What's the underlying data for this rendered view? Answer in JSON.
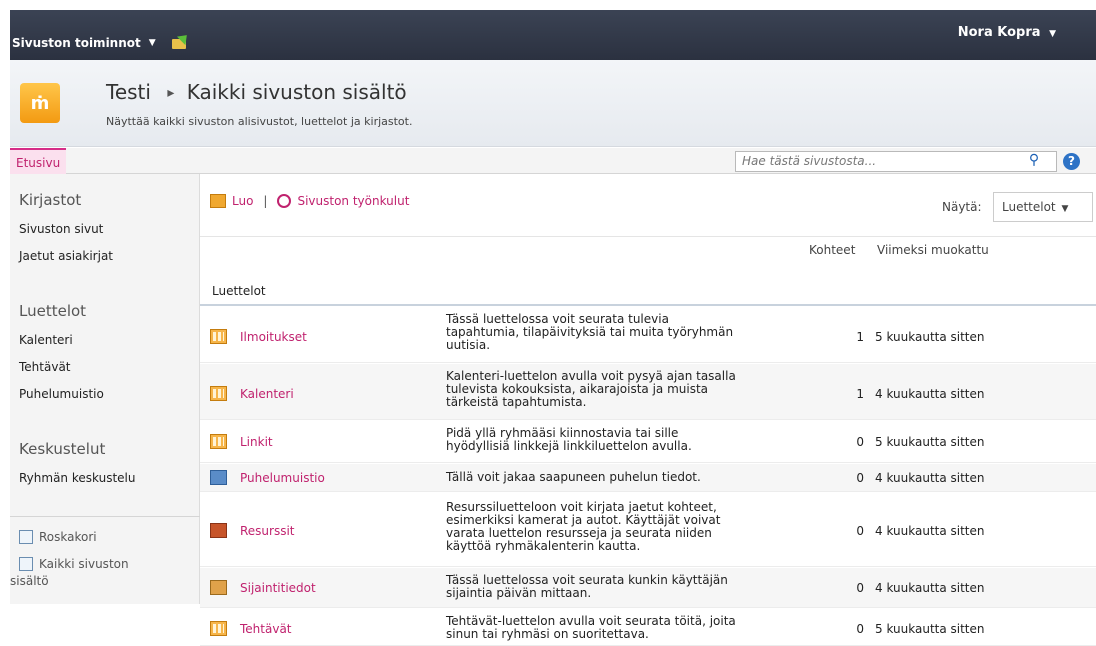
{
  "topbar": {
    "site_actions": "Sivuston toiminnot",
    "user_name": "Nora Kopra"
  },
  "title_area": {
    "site_name": "Testi",
    "page_name": "Kaikki sivuston sisältö",
    "description": "Näyttää kaikki sivuston alisivustot, luettelot ja kirjastot."
  },
  "linkbar": {
    "home_tab": "Etusivu",
    "search_placeholder": "Hae tästä sivustosta..."
  },
  "quicklaunch": {
    "libraries_heading": "Kirjastot",
    "libraries": [
      "Sivuston sivut",
      "Jaetut asiakirjat"
    ],
    "lists_heading": "Luettelot",
    "lists": [
      "Kalenteri",
      "Tehtävät",
      "Puhelumuistio"
    ],
    "discussions_heading": "Keskustelut",
    "discussions": [
      "Ryhmän keskustelu"
    ],
    "recycle_bin": "Roskakori",
    "all_content_line1": "Kaikki sivuston",
    "all_content_line2": "sisältö"
  },
  "toolbar": {
    "create": "Luo",
    "separator": "|",
    "site_workflows": "Sivuston työnkulut",
    "view_label": "Näytä:",
    "view_value": "Luettelot"
  },
  "columns": {
    "items": "Kohteet",
    "modified": "Viimeksi muokattu"
  },
  "section": {
    "title": "Luettelot"
  },
  "rows": [
    {
      "icon": "list-icon",
      "name": "Ilmoitukset",
      "desc1": "Tässä luettelossa voit seurata tulevia",
      "desc2": "tapahtumia, tilapäivityksiä tai muita työryhmän",
      "desc3": "uutisia.",
      "desc4": "",
      "count": "1",
      "modified": "5 kuukautta sitten"
    },
    {
      "icon": "calendar-icon",
      "name": "Kalenteri",
      "desc1": "Kalenteri-luettelon avulla voit pysyä ajan tasalla",
      "desc2": "tulevista kokouksista, aikarajoista ja muista",
      "desc3": "tärkeistä tapahtumista.",
      "desc4": "",
      "count": "1",
      "modified": "4 kuukautta sitten"
    },
    {
      "icon": "links-icon",
      "name": "Linkit",
      "desc1": "Pidä yllä ryhmääsi kiinnostavia tai sille",
      "desc2": "hyödyllisiä linkkejä linkkiluettelon avulla.",
      "desc3": "",
      "desc4": "",
      "count": "0",
      "modified": "5 kuukautta sitten"
    },
    {
      "icon": "phone-icon",
      "name": "Puhelumuistio",
      "desc1": "Tällä voit jakaa saapuneen puhelun tiedot.",
      "desc2": "",
      "desc3": "",
      "desc4": "",
      "count": "0",
      "modified": "4 kuukautta sitten"
    },
    {
      "icon": "resources-icon",
      "name": "Resurssit",
      "desc1": "Resurssiluetteloon voit kirjata jaetut kohteet,",
      "desc2": "esimerkiksi kamerat ja autot. Käyttäjät voivat",
      "desc3": "varata luettelon resursseja ja seurata niiden",
      "desc4": "käyttöä ryhmäkalenterin kautta.",
      "count": "0",
      "modified": "4 kuukautta sitten"
    },
    {
      "icon": "location-icon",
      "name": "Sijaintitiedot",
      "desc1": "Tässä luettelossa voit seurata kunkin käyttäjän",
      "desc2": "sijaintia päivän mittaan.",
      "desc3": "",
      "desc4": "",
      "count": "0",
      "modified": "4 kuukautta sitten"
    },
    {
      "icon": "tasks-icon",
      "name": "Tehtävät",
      "desc1": "Tehtävät-luettelon avulla voit seurata töitä, joita",
      "desc2": "sinun tai ryhmäsi on suoritettava.",
      "desc3": "",
      "desc4": "",
      "count": "0",
      "modified": "5 kuukautta sitten"
    }
  ]
}
